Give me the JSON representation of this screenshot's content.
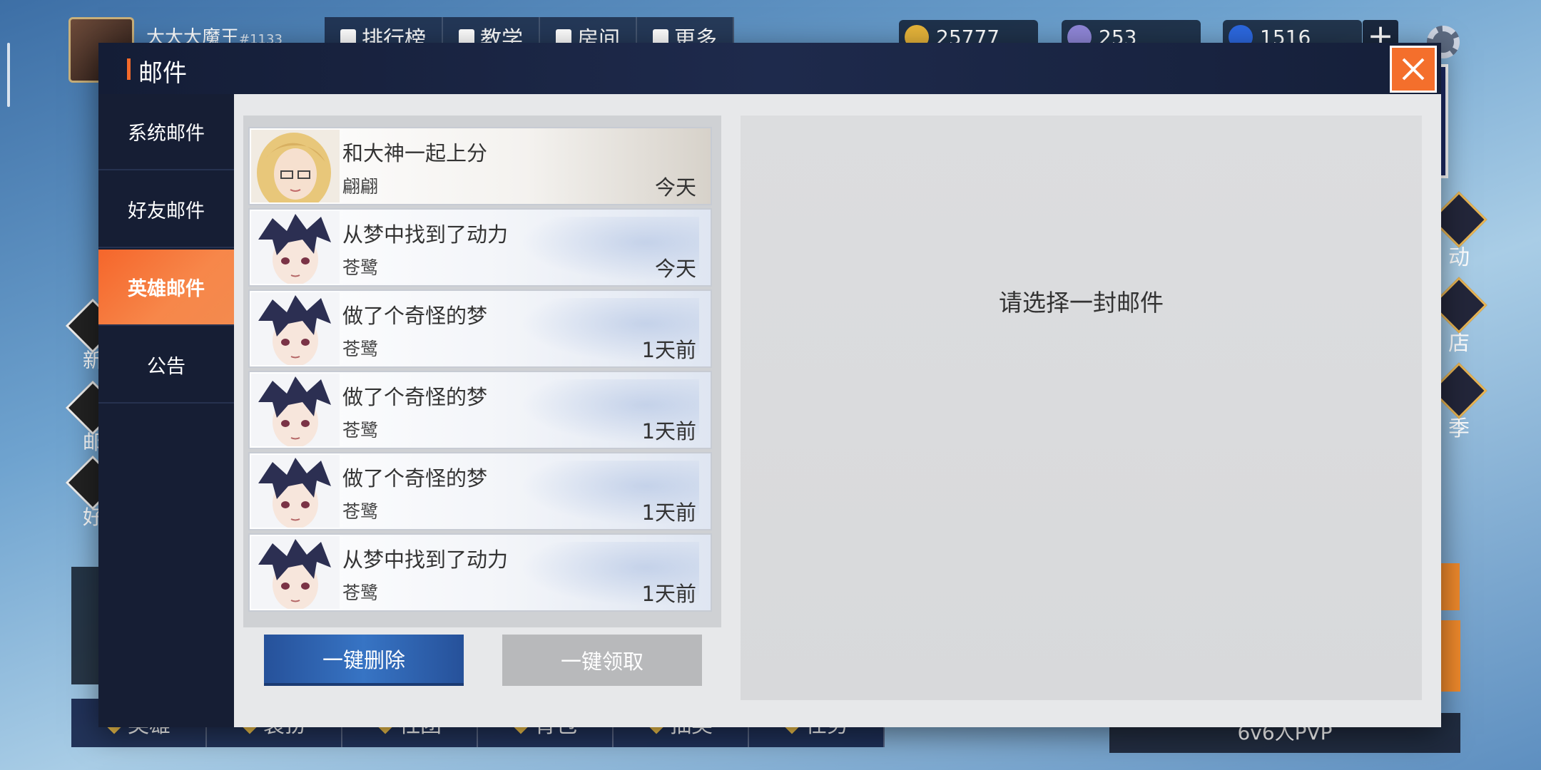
{
  "background": {
    "player": {
      "name": "大大大魔王",
      "tag": "#1133"
    },
    "nav_tabs": [
      "排行榜",
      "教学",
      "房间",
      "更多"
    ],
    "resources": [
      {
        "icon": "gold-coin-icon",
        "value": "25777",
        "color": "#e6b43a"
      },
      {
        "icon": "crystal-icon",
        "value": "253",
        "color": "#8f86d8"
      },
      {
        "icon": "gem-icon",
        "value": "1516",
        "color": "#2c68e0"
      }
    ],
    "left_buttons": [
      "新",
      "邮",
      "好"
    ],
    "right_buttons": [
      "动",
      "店",
      "季"
    ],
    "bottom_nav": [
      "英雄",
      "装扮",
      "社团",
      "背包",
      "抽奖",
      "任务"
    ],
    "pvp_label": "6v6人PVP"
  },
  "dialog": {
    "title": "邮件",
    "tabs": [
      {
        "label": "系统邮件",
        "active": false
      },
      {
        "label": "好友邮件",
        "active": false
      },
      {
        "label": "英雄邮件",
        "active": true
      },
      {
        "label": "公告",
        "active": false
      }
    ],
    "mails": [
      {
        "subject": "和大神一起上分",
        "sender": "翩翩",
        "time": "今天",
        "avatar": "blonde-girl-avatar"
      },
      {
        "subject": "从梦中找到了动力",
        "sender": "苍鹭",
        "time": "今天",
        "avatar": "dark-haired-boy-avatar"
      },
      {
        "subject": "做了个奇怪的梦",
        "sender": "苍鹭",
        "time": "1天前",
        "avatar": "dark-haired-boy-avatar"
      },
      {
        "subject": "做了个奇怪的梦",
        "sender": "苍鹭",
        "time": "1天前",
        "avatar": "dark-haired-boy-avatar"
      },
      {
        "subject": "做了个奇怪的梦",
        "sender": "苍鹭",
        "time": "1天前",
        "avatar": "dark-haired-boy-avatar"
      },
      {
        "subject": "从梦中找到了动力",
        "sender": "苍鹭",
        "time": "1天前",
        "avatar": "dark-haired-boy-avatar"
      }
    ],
    "delete_all_label": "一键删除",
    "claim_all_label": "一键领取",
    "empty_detail_text": "请选择一封邮件",
    "colors": {
      "accent": "#f46f2c",
      "header": "#1a2442",
      "primary_button": "#3774c4",
      "disabled_button": "#b8b9bb"
    }
  }
}
